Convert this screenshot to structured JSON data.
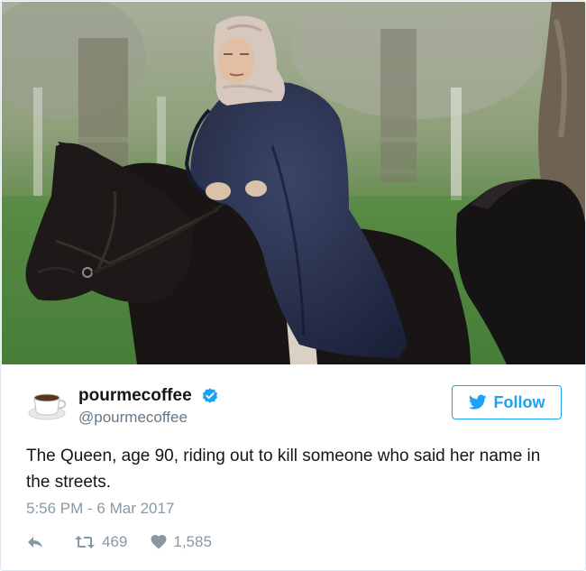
{
  "tweet": {
    "display_name": "pourmecoffee",
    "handle": "@pourmecoffee",
    "verified": true,
    "follow_label": "Follow",
    "text": "The Queen, age 90, riding out to kill someone who said her name in the streets.",
    "timestamp": "5:56 PM - 6 Mar 2017",
    "retweets": "469",
    "likes": "1,585"
  },
  "icons": {
    "avatar": "coffee-cup-icon",
    "verified": "verified-badge-icon",
    "follow": "twitter-bird-icon",
    "reply": "reply-arrow-icon",
    "retweet": "retweet-icon",
    "like": "heart-icon"
  },
  "colors": {
    "accent": "#1da1f2",
    "muted": "#8899a6",
    "text": "#14171a"
  }
}
